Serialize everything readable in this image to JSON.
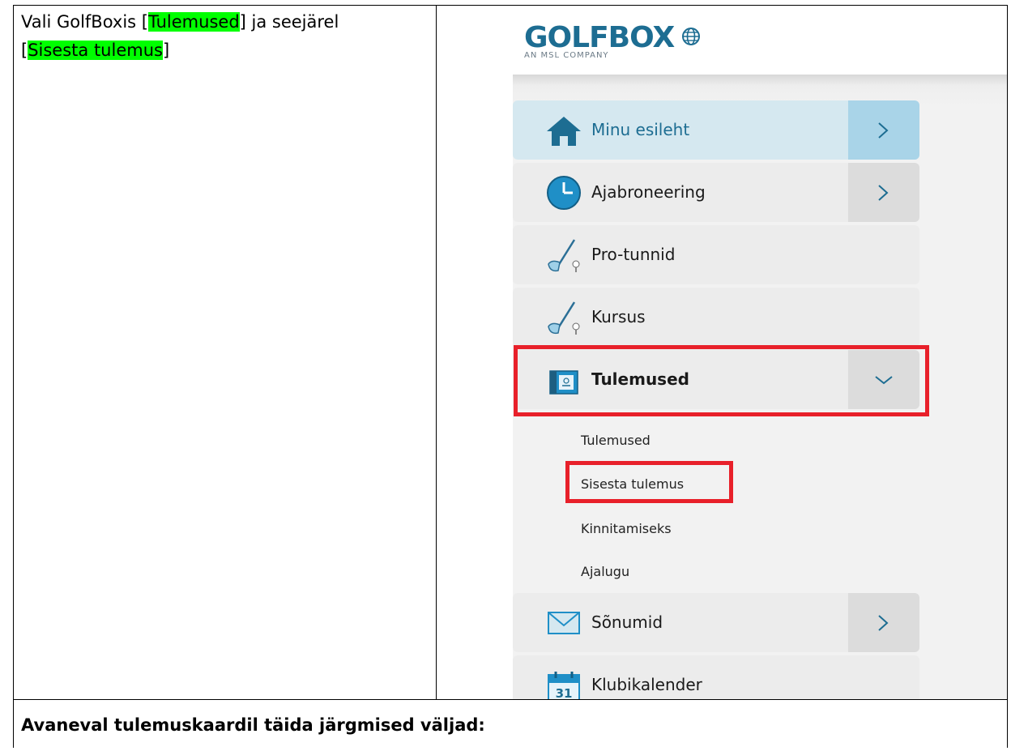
{
  "instruction": {
    "part1": "Vali GolfBoxis [",
    "hl1": "Tulemused",
    "part2": "] ja seejärel",
    "part3": "[",
    "hl2": "Sisesta tulemus",
    "part4": "]"
  },
  "bottom_text": "Avaneval tulemuskaardil täida järgmised väljad:",
  "logo": {
    "word": "GOLFBOX",
    "subtitle": "AN MSL COMPANY",
    "color": "#1d6d92"
  },
  "menu": {
    "items": [
      {
        "label": "Minu esileht",
        "icon": "home-icon",
        "arrow": "chevron-right"
      },
      {
        "label": "Ajabroneering",
        "icon": "clock-icon",
        "arrow": "chevron-right"
      },
      {
        "label": "Pro-tunnid",
        "icon": "golf-club-icon"
      },
      {
        "label": "Kursus",
        "icon": "golf-club-icon"
      },
      {
        "label": "Tulemused",
        "icon": "scorecard-icon",
        "arrow": "chevron-down"
      },
      {
        "label": "Sõnumid",
        "icon": "envelope-icon",
        "arrow": "chevron-right"
      },
      {
        "label": "Klubikalender",
        "icon": "calendar-icon",
        "calendar_day": "31"
      }
    ],
    "submenu": [
      "Tulemused",
      "Sisesta tulemus",
      "Kinnitamiseks",
      "Ajalugu"
    ]
  },
  "colors": {
    "highlight": "#00ff00",
    "annotation_red": "#e8202a",
    "active_bg": "#d5e8f0"
  }
}
